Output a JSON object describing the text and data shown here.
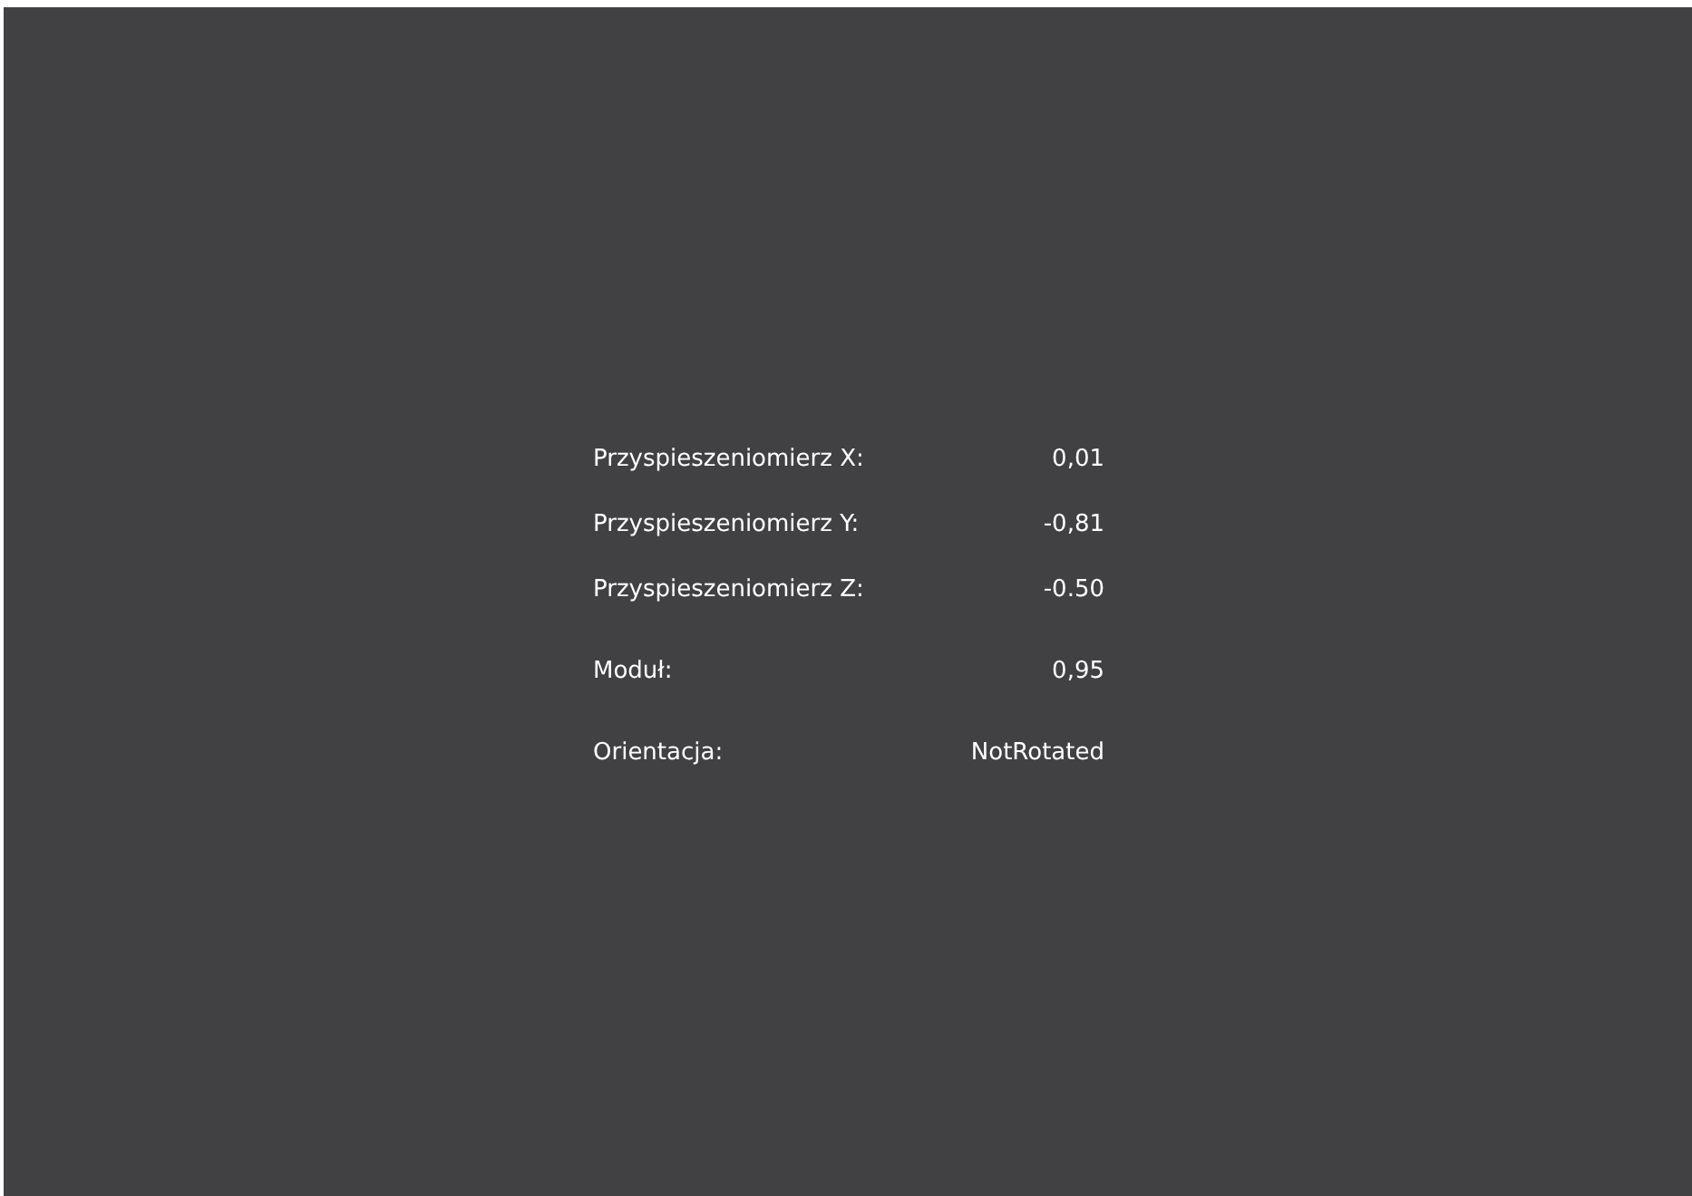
{
  "readings": [
    {
      "label": "Przyspieszeniomierz X:",
      "value": "0,01"
    },
    {
      "label": "Przyspieszeniomierz Y:",
      "value": "-0,81"
    },
    {
      "label": "Przyspieszeniomierz Z:",
      "value": "-0.50"
    },
    {
      "label": "Moduł:",
      "value": "0,95",
      "gap": true
    },
    {
      "label": "Orientacja:",
      "value": "NotRotated",
      "gap": true
    }
  ]
}
